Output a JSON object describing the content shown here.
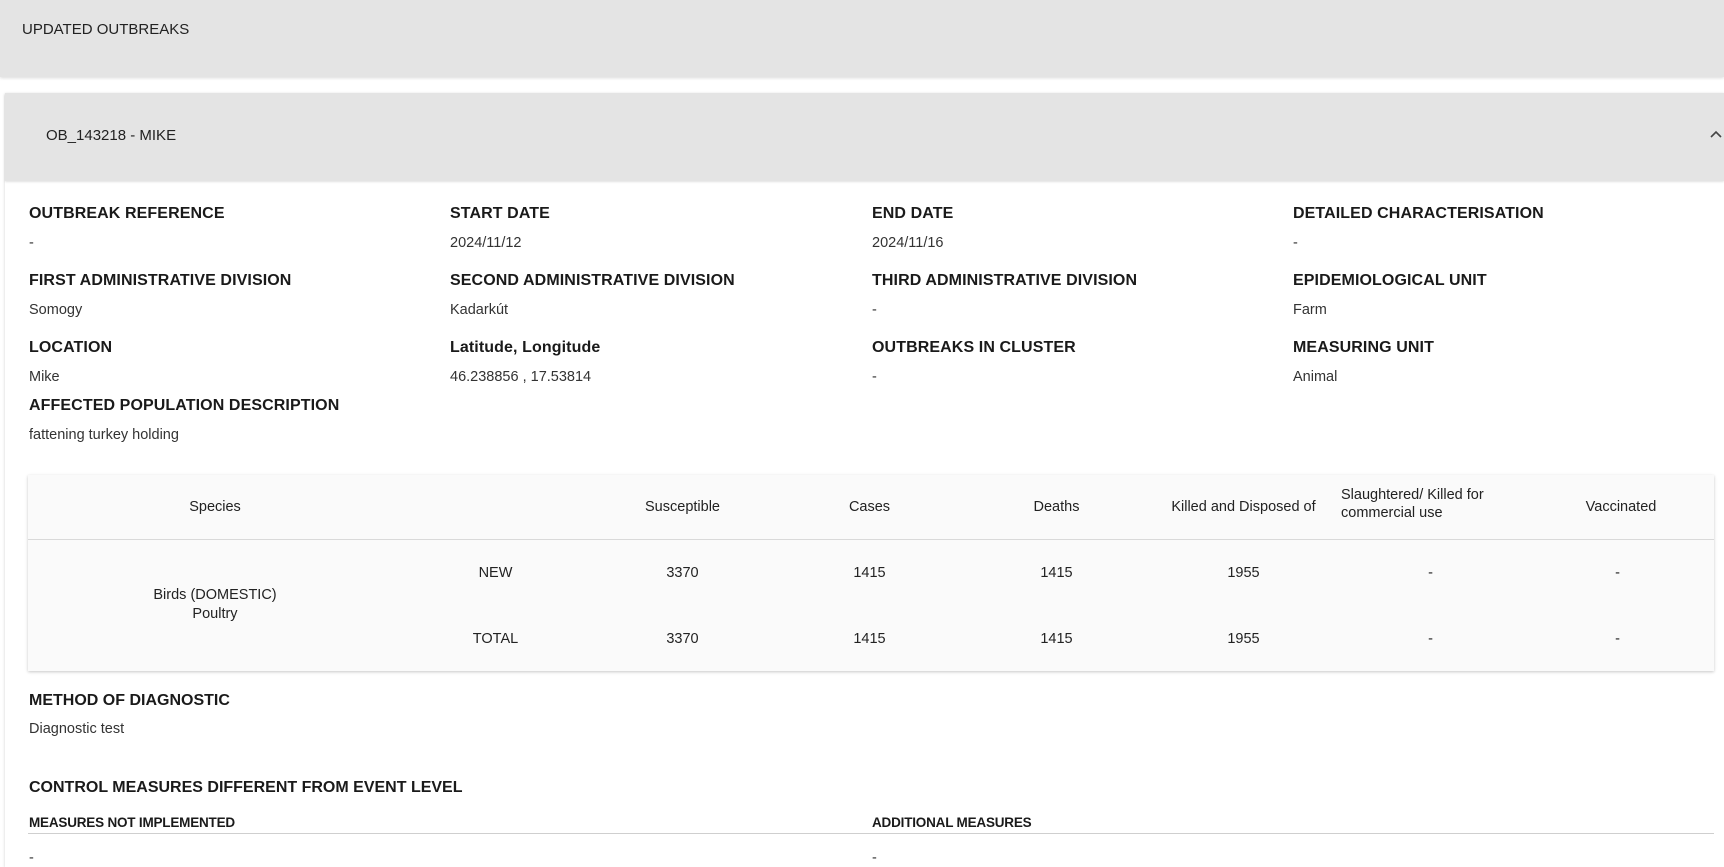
{
  "header": {
    "title": "UPDATED OUTBREAKS"
  },
  "outbreak": {
    "title": "OB_143218 - MIKE"
  },
  "fields": [
    {
      "label": "OUTBREAK REFERENCE",
      "value": "-"
    },
    {
      "label": "START DATE",
      "value": "2024/11/12"
    },
    {
      "label": "END DATE",
      "value": "2024/11/16"
    },
    {
      "label": "DETAILED CHARACTERISATION",
      "value": "-"
    },
    {
      "label": "FIRST ADMINISTRATIVE DIVISION",
      "value": "Somogy"
    },
    {
      "label": "SECOND ADMINISTRATIVE DIVISION",
      "value": "Kadarkút"
    },
    {
      "label": "THIRD ADMINISTRATIVE DIVISION",
      "value": "-"
    },
    {
      "label": "EPIDEMIOLOGICAL UNIT",
      "value": "Farm"
    },
    {
      "label": "LOCATION",
      "value": "Mike"
    },
    {
      "label": "Latitude, Longitude",
      "value": "46.238856 , 17.53814"
    },
    {
      "label": "OUTBREAKS IN CLUSTER",
      "value": "-"
    },
    {
      "label": "MEASURING UNIT",
      "value": "Animal"
    },
    {
      "label": "AFFECTED POPULATION DESCRIPTION",
      "value": "fattening turkey holding"
    }
  ],
  "table": {
    "headers": {
      "species": "Species",
      "susceptible": "Susceptible",
      "cases": "Cases",
      "deaths": "Deaths",
      "killed": "Killed and Disposed of",
      "slaughtered_1": "Slaughtered/ Killed for",
      "slaughtered_2": "commercial use",
      "vaccinated": "Vaccinated"
    },
    "species_line1": "Birds (DOMESTIC)",
    "species_line2": "Poultry",
    "rows": [
      {
        "type": "NEW",
        "susceptible": "3370",
        "cases": "1415",
        "deaths": "1415",
        "killed": "1955",
        "slaughtered": "-",
        "vaccinated": "-"
      },
      {
        "type": "TOTAL",
        "susceptible": "3370",
        "cases": "1415",
        "deaths": "1415",
        "killed": "1955",
        "slaughtered": "-",
        "vaccinated": "-"
      }
    ]
  },
  "method": {
    "label": "METHOD OF DIAGNOSTIC",
    "value": "Diagnostic test"
  },
  "control": {
    "label": "CONTROL MEASURES DIFFERENT FROM EVENT LEVEL",
    "not_implemented_label": "MEASURES NOT IMPLEMENTED",
    "not_implemented_value": "-",
    "additional_label": "ADDITIONAL MEASURES",
    "additional_value": "-"
  },
  "icons": {
    "collapse": "chevron-up-icon"
  }
}
